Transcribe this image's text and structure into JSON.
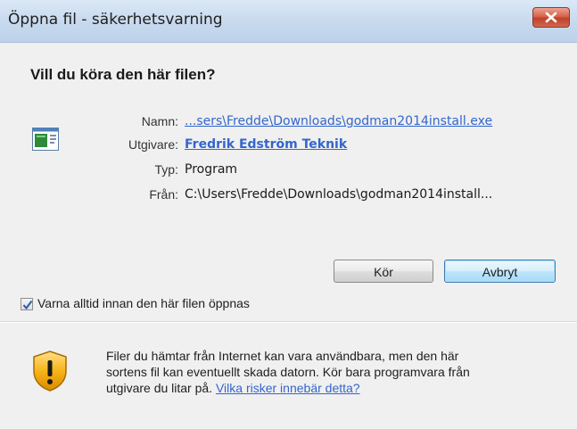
{
  "window": {
    "title": "Öppna fil - säkerhetsvarning",
    "close_icon": "close-x-icon"
  },
  "dialog": {
    "heading": "Vill du köra den här filen?",
    "file_icon": "executable-file-icon",
    "fields": {
      "name_label": "Namn:",
      "name_value": "...sers\\Fredde\\Downloads\\godman2014install.exe",
      "publisher_label": "Utgivare:",
      "publisher_value": "Fredrik Edström Teknik",
      "type_label": "Typ:",
      "type_value": "Program",
      "from_label": "Från:",
      "from_value": "C:\\Users\\Fredde\\Downloads\\godman2014install..."
    },
    "buttons": {
      "run_label": "Kör",
      "cancel_label": "Avbryt"
    },
    "checkbox": {
      "checked": true,
      "label": "Varna alltid innan den här filen öppnas"
    }
  },
  "footer": {
    "icon": "warning-shield-icon",
    "line1": "Filer du hämtar från Internet kan vara användbara, men den här",
    "line2": "sortens fil kan eventuellt skada datorn. Kör bara programvara från",
    "line3_prefix": "utgivare du litar på.",
    "risk_link": "Vilka risker innebär detta?"
  },
  "colors": {
    "link": "#3366cc",
    "titlebar": "#c7d9ee",
    "close_button": "#c8442d",
    "dialog_bg": "#f0f0f0"
  }
}
